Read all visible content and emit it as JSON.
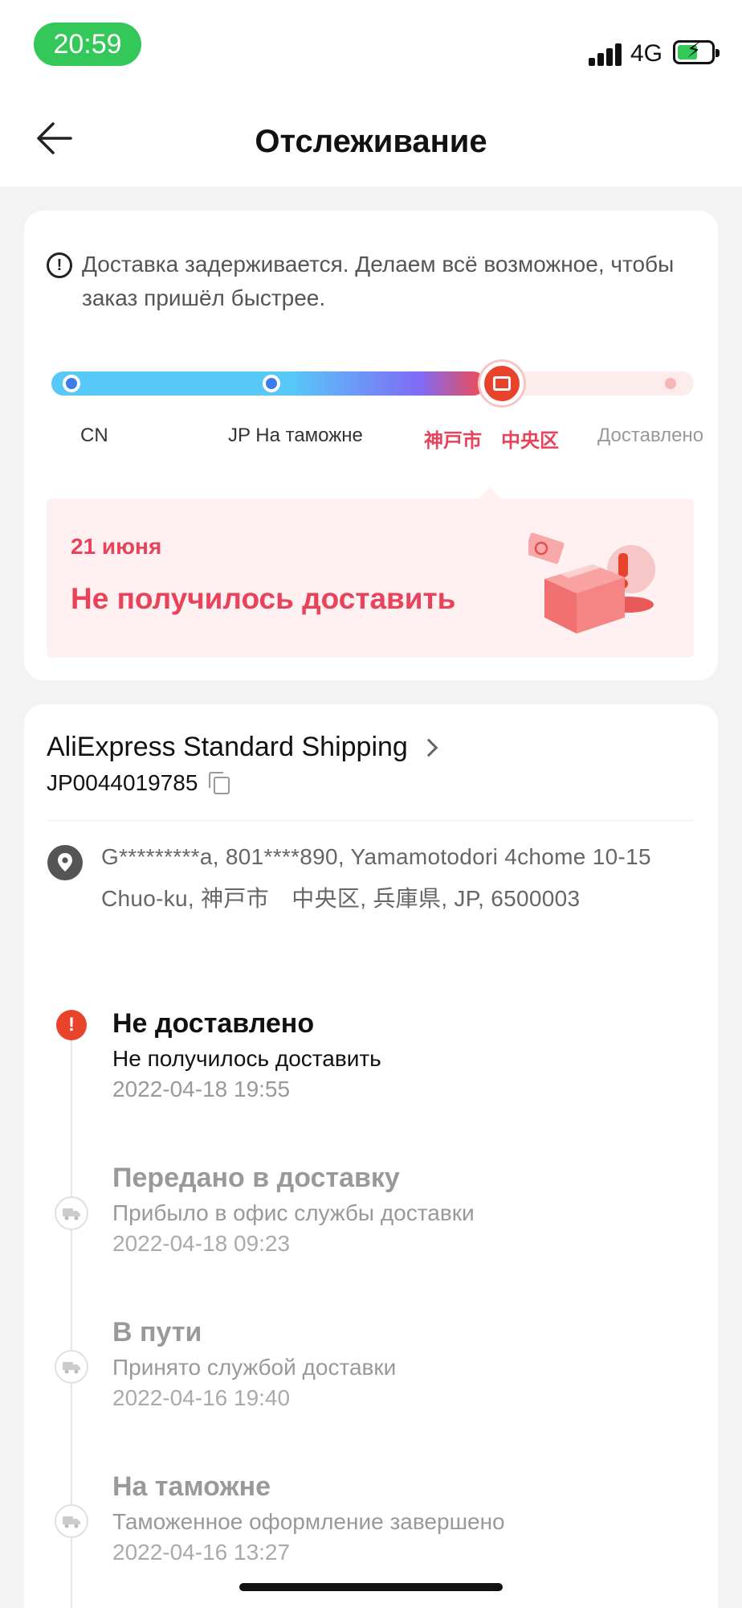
{
  "status_bar": {
    "time": "20:59",
    "network": "4G"
  },
  "header": {
    "title": "Отслеживание"
  },
  "notice": {
    "text": "Доставка задерживается. Делаем всё возможное, чтобы заказ пришёл быстрее."
  },
  "progress": {
    "stages": [
      {
        "label": "CN"
      },
      {
        "label": "JP На таможне"
      },
      {
        "label": "神戸市　中央区"
      },
      {
        "label": "Доставлено"
      }
    ],
    "current_index": 2
  },
  "status_box": {
    "date": "21 июня",
    "title": "Не получилось доставить"
  },
  "shipping": {
    "carrier": "AliExpress Standard Shipping",
    "tracking_number": "JP0044019785",
    "address": "G*********a,  801****890,  Yamamotodori 4chome 10-15 Chuo-ku,  神戸市　中央区,  兵庫県,  JP,  6500003"
  },
  "events": [
    {
      "title": "Не доставлено",
      "desc": "Не получилось доставить",
      "time": "2022-04-18 19:55"
    },
    {
      "title": "Передано в доставку",
      "desc": "Прибыло в офис службы доставки",
      "time": "2022-04-18 09:23"
    },
    {
      "title": "В пути",
      "desc": "Принято службой доставки",
      "time": "2022-04-16 19:40"
    },
    {
      "title": "На таможне",
      "desc": "Таможенное оформление завершено",
      "time": "2022-04-16 13:27"
    }
  ],
  "colors": {
    "accent": "#e8435a",
    "progress_blue": "#58c8f8",
    "alert": "#e8442c",
    "time_pill": "#34c759"
  }
}
